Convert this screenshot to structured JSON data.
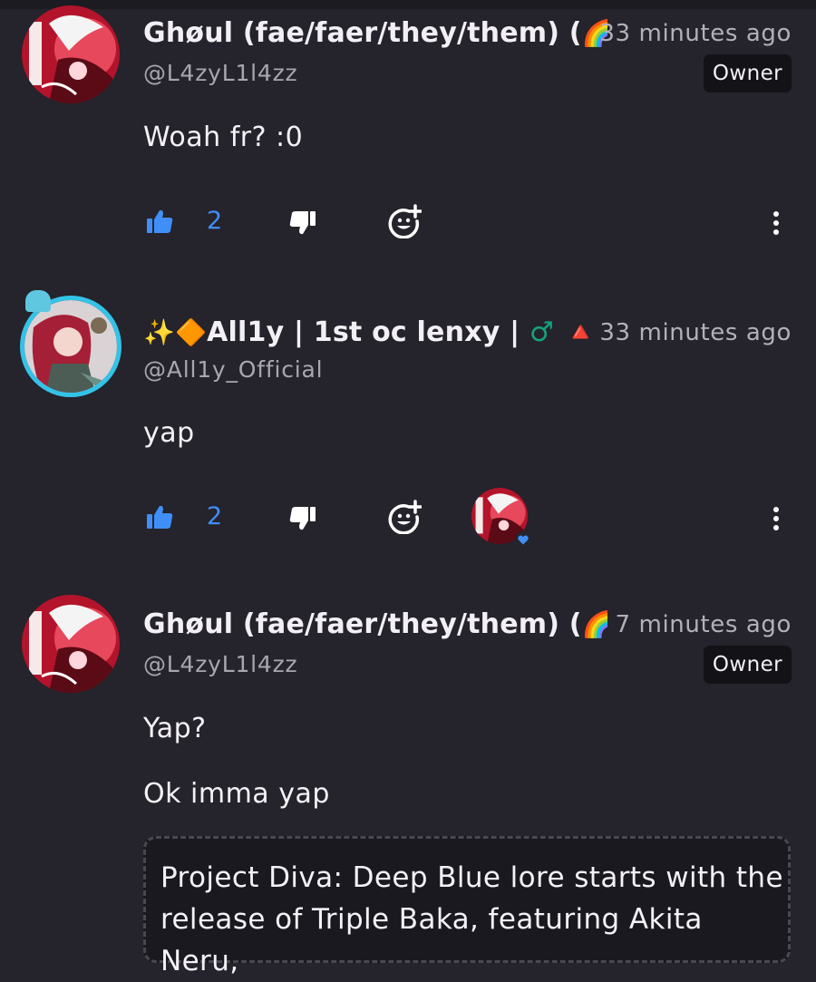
{
  "comments": [
    {
      "author_name": "Ghøul (fae/faer/they/them) (",
      "author_emojis": "🌈🦋",
      "handle": "@L4zyL1l4zz",
      "timestamp": "33 minutes ago",
      "badge": "Owner",
      "lines": [
        "Woah fr? :0"
      ],
      "like_count": "2",
      "avatar_icon": "red-anime-avatar"
    },
    {
      "author_prefix": "✨🔶",
      "author_name": "All1y | 1st oc lenxy | ",
      "author_suffix": "♂ 🔺",
      "handle": "@All1y_Official",
      "timestamp": "33 minutes ago",
      "lines": [
        "yap"
      ],
      "like_count": "2",
      "avatar_icon": "anime-girl-avatar",
      "heart_by_icon": "red-anime-avatar"
    },
    {
      "author_name": "Ghøul (fae/faer/they/them) (",
      "author_emojis": "🌈🦋",
      "handle": "@L4zyL1l4zz",
      "timestamp": "7 minutes ago",
      "badge": "Owner",
      "lines": [
        "Yap?",
        "Ok imma yap"
      ],
      "quote": "Project Diva: Deep Blue lore starts with the release of Triple Baka, featuring Akita Neru,",
      "avatar_icon": "red-anime-avatar"
    }
  ],
  "colors": {
    "background": "#25232b",
    "accent_blue": "#3f8ff7",
    "muted_text": "#a9a6b0",
    "badge_bg": "#131217"
  }
}
